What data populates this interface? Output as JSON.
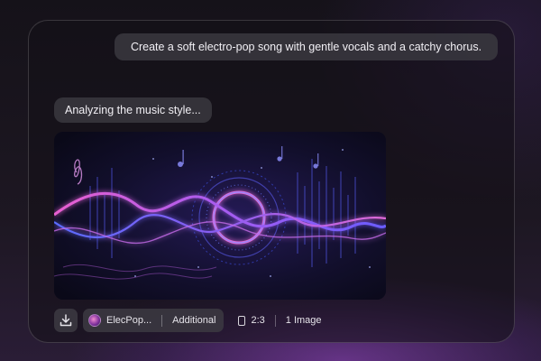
{
  "chat": {
    "user_prompt": "Create a soft electro-pop song with gentle vocals and a catchy chorus.",
    "status": "Analyzing the music style..."
  },
  "toolbar": {
    "download_icon": "download-icon",
    "style_name": "ElecPop...",
    "style_extra": "Additional",
    "ratio": "2:3",
    "count": "1 Image"
  },
  "colors": {
    "accent_pink": "#e86bd6",
    "accent_blue": "#5a6cff",
    "accent_purple": "#9a4de0"
  }
}
